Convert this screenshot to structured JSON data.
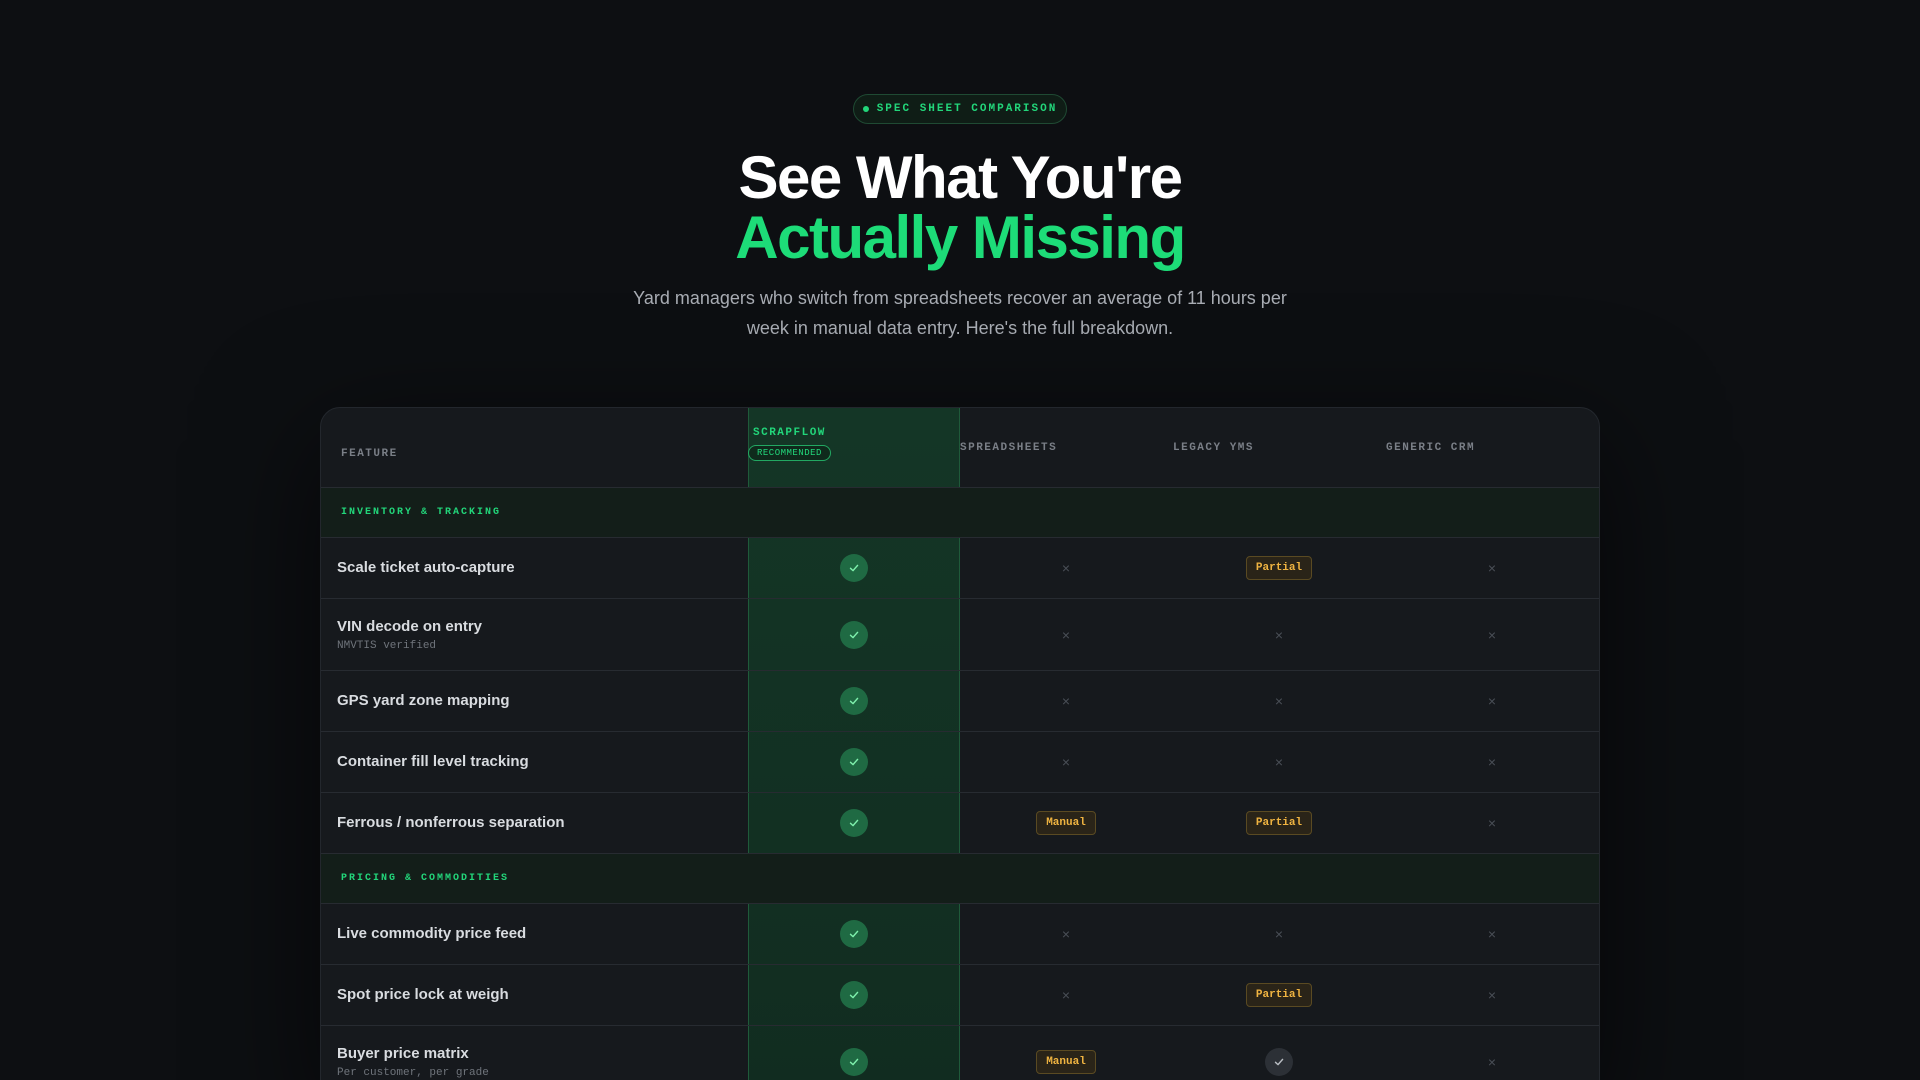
{
  "hero": {
    "badge": "SPEC SHEET COMPARISON",
    "title_line1": "See What You're",
    "title_line2": "Actually Missing",
    "subtitle": "Yard managers who switch from spreadsheets recover an average of 11 hours per week in manual data entry. Here's the full breakdown."
  },
  "table": {
    "headers": {
      "feature": "FEATURE",
      "col1": "SCRAPFLOW",
      "col1_badge": "RECOMMENDED",
      "col2": "SPREADSHEETS",
      "col3": "LEGACY YMS",
      "col4": "GENERIC CRM"
    },
    "sections": [
      {
        "label": "INVENTORY & TRACKING",
        "rows": [
          {
            "name": "Scale ticket auto-capture",
            "sub": "",
            "values": [
              "check",
              "cross",
              "Partial",
              "cross"
            ]
          },
          {
            "name": "VIN decode on entry",
            "sub": "NMVTIS verified",
            "values": [
              "check",
              "cross",
              "cross",
              "cross"
            ]
          },
          {
            "name": "GPS yard zone mapping",
            "sub": "",
            "values": [
              "check",
              "cross",
              "cross",
              "cross"
            ]
          },
          {
            "name": "Container fill level tracking",
            "sub": "",
            "values": [
              "check",
              "cross",
              "cross",
              "cross"
            ]
          },
          {
            "name": "Ferrous / nonferrous separation",
            "sub": "",
            "values": [
              "check",
              "Manual",
              "Partial",
              "cross"
            ]
          }
        ]
      },
      {
        "label": "PRICING & COMMODITIES",
        "rows": [
          {
            "name": "Live commodity price feed",
            "sub": "",
            "values": [
              "check",
              "cross",
              "cross",
              "cross"
            ]
          },
          {
            "name": "Spot price lock at weigh",
            "sub": "",
            "values": [
              "check",
              "cross",
              "Partial",
              "cross"
            ]
          },
          {
            "name": "Buyer price matrix",
            "sub": "Per customer, per grade",
            "values": [
              "check",
              "Manual",
              "check-grey",
              "cross"
            ]
          }
        ]
      }
    ]
  },
  "icons": {
    "check": "check-icon",
    "cross": "cross-icon"
  },
  "colors": {
    "accent": "#1ddc78",
    "warning": "#f0b441",
    "background": "#0d0f12"
  }
}
